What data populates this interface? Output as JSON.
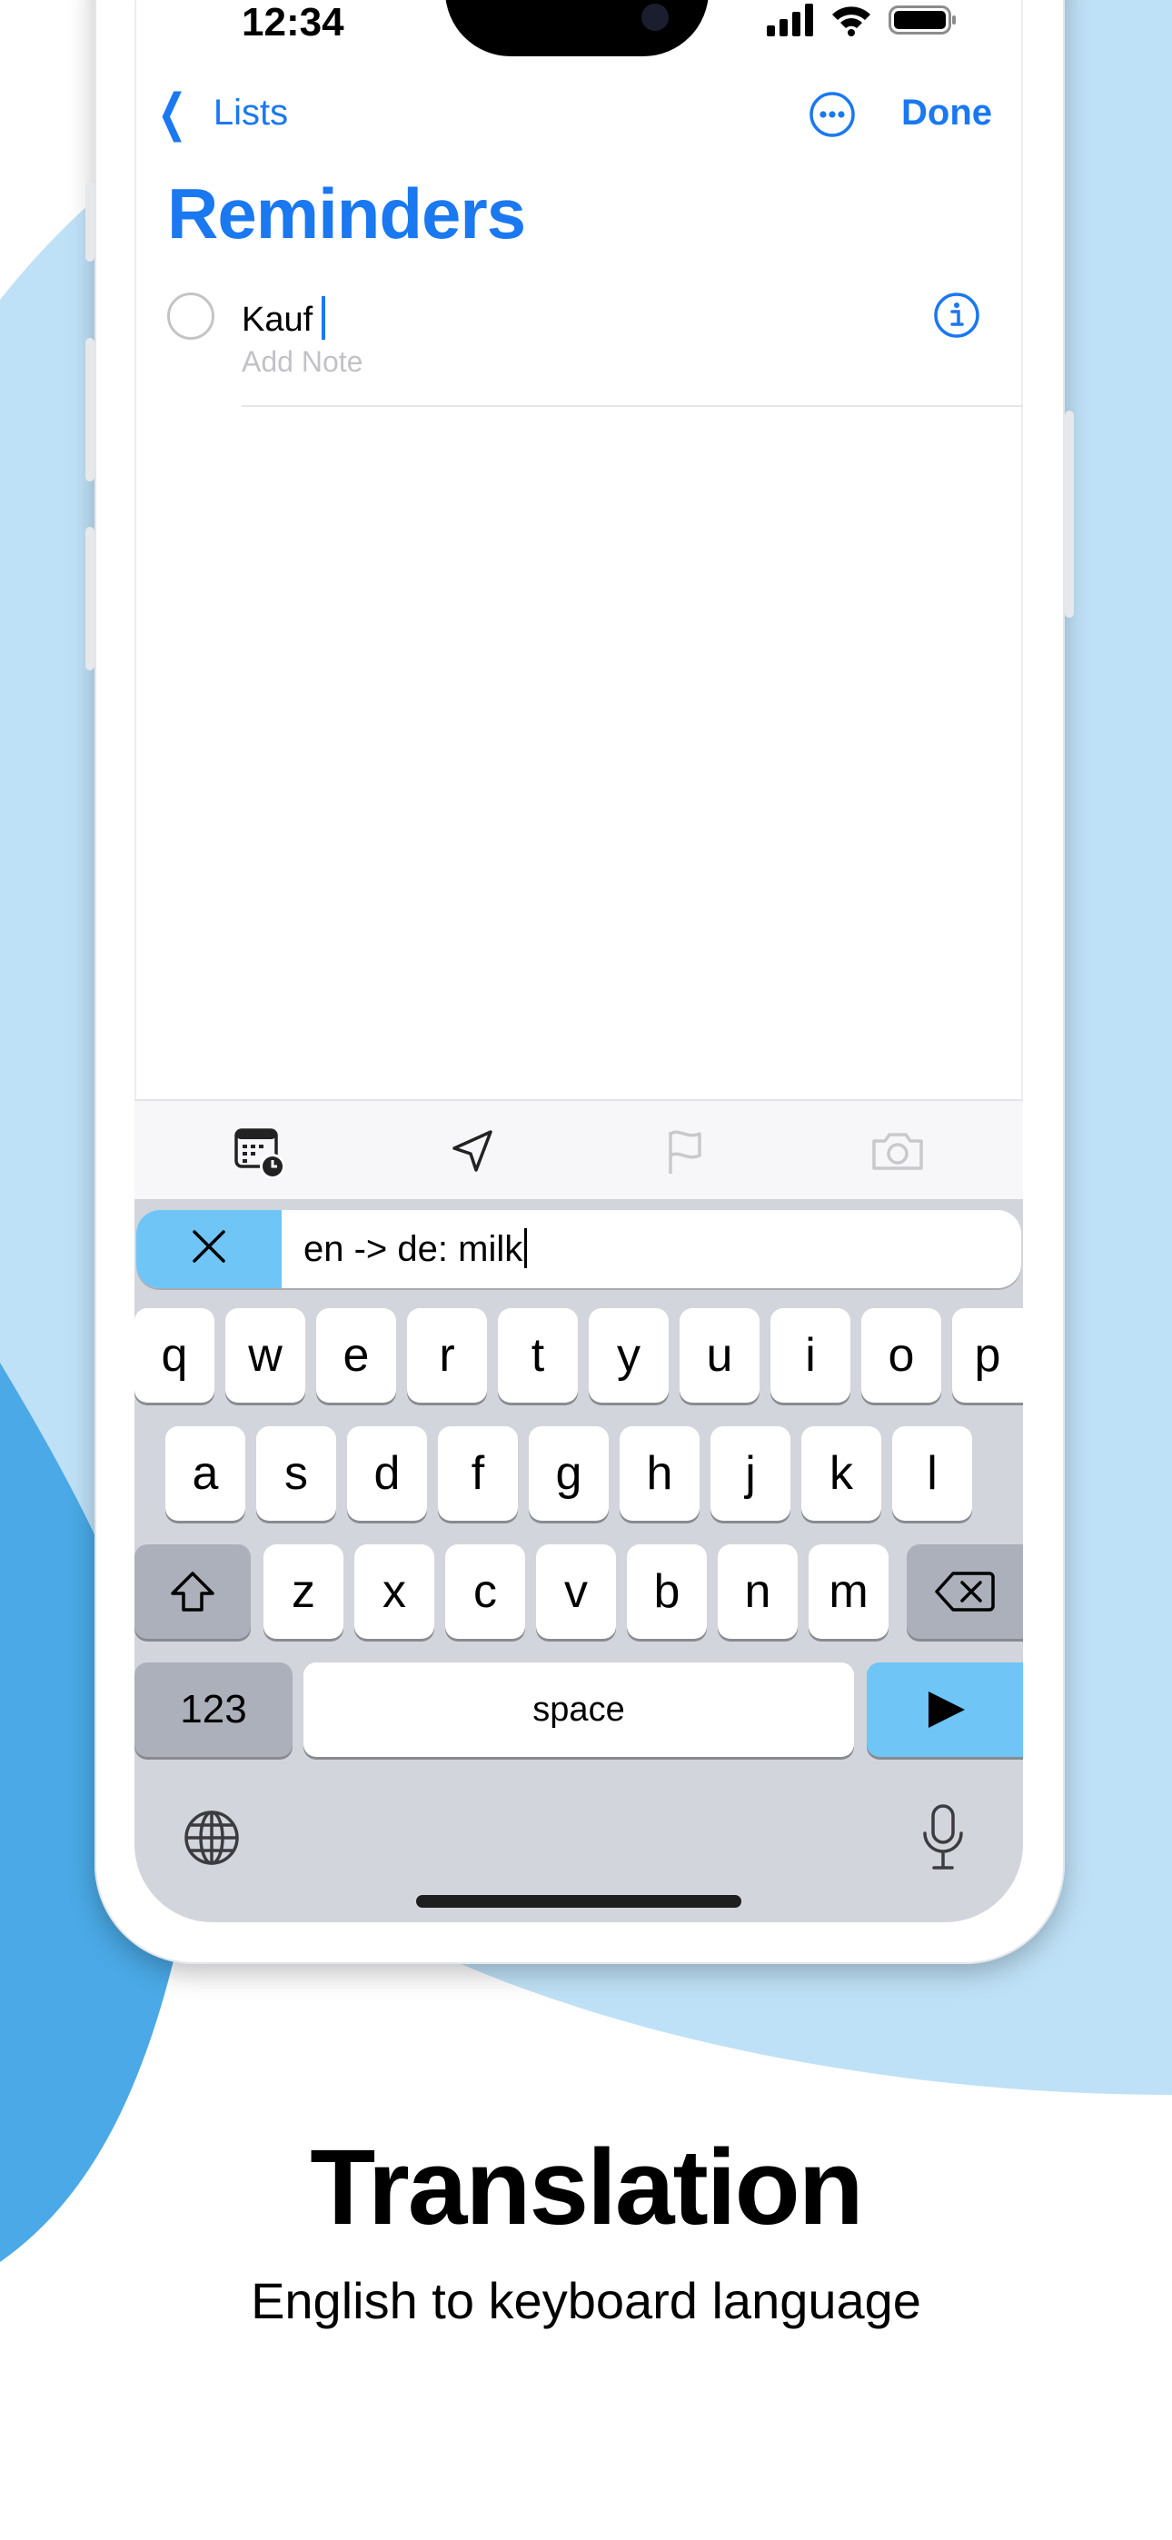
{
  "status_bar": {
    "time": "12:34"
  },
  "nav": {
    "back_label": "Lists",
    "done_label": "Done"
  },
  "list": {
    "title": "Reminders"
  },
  "reminder": {
    "title": "Kauf",
    "note_placeholder": "Add Note"
  },
  "translation_bar": {
    "text": "en -> de: milk"
  },
  "keyboard": {
    "row1": [
      "q",
      "w",
      "e",
      "r",
      "t",
      "y",
      "u",
      "i",
      "o",
      "p"
    ],
    "row2": [
      "a",
      "s",
      "d",
      "f",
      "g",
      "h",
      "j",
      "k",
      "l"
    ],
    "row3": [
      "z",
      "x",
      "c",
      "v",
      "b",
      "n",
      "m"
    ],
    "numbers_label": "123",
    "space_label": "space"
  },
  "caption": {
    "title": "Translation",
    "subtitle": "English to keyboard language"
  },
  "colors": {
    "accent": "#1a78f0",
    "translate_blue": "#6ec5f6",
    "bg_light": "#bfe1f7",
    "bg_dark": "#4aa9e6"
  }
}
